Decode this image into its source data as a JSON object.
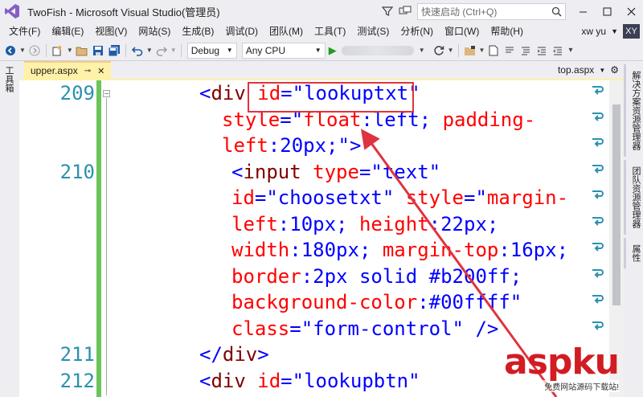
{
  "window": {
    "title": "TwoFish - Microsoft Visual Studio(管理员)",
    "quick_launch_placeholder": "快速启动 (Ctrl+Q)"
  },
  "menu": {
    "items": [
      "文件(F)",
      "编辑(E)",
      "视图(V)",
      "网站(S)",
      "生成(B)",
      "调试(D)",
      "团队(M)",
      "工具(T)",
      "测试(S)",
      "分析(N)",
      "窗口(W)",
      "帮助(H)"
    ],
    "user_name": "xw yu",
    "user_initials": "XY"
  },
  "toolbar": {
    "config_value": "Debug",
    "platform_value": "Any CPU"
  },
  "left_panel": {
    "label": "工具箱"
  },
  "right_panel": {
    "tabs": [
      "解决方案资源管理器",
      "团队资源管理器",
      "属性"
    ]
  },
  "tabs": {
    "active": "upper.aspx",
    "other": "top.aspx"
  },
  "editor": {
    "lines": [
      {
        "num": "209",
        "segments": [
          {
            "t": "<",
            "c": "str"
          },
          {
            "t": "div",
            "c": "tag"
          },
          {
            "t": " ",
            "c": "plain"
          },
          {
            "t": "id",
            "c": "attr"
          },
          {
            "t": "=\"lookuptxt\"",
            "c": "str"
          }
        ]
      },
      {
        "num": "",
        "segments": [
          {
            "t": "style",
            "c": "attr"
          },
          {
            "t": "=\"",
            "c": "str"
          },
          {
            "t": "float",
            "c": "attr"
          },
          {
            "t": ":left; ",
            "c": "str"
          },
          {
            "t": "padding-",
            "c": "attr"
          }
        ]
      },
      {
        "num": "",
        "segments": [
          {
            "t": "left",
            "c": "attr"
          },
          {
            "t": ":20px;\">",
            "c": "str"
          }
        ]
      },
      {
        "num": "210",
        "segments": [
          {
            "t": "<",
            "c": "str"
          },
          {
            "t": "input",
            "c": "tag"
          },
          {
            "t": " ",
            "c": "plain"
          },
          {
            "t": "type",
            "c": "attr"
          },
          {
            "t": "=\"text\"",
            "c": "str"
          }
        ]
      },
      {
        "num": "",
        "segments": [
          {
            "t": "id",
            "c": "attr"
          },
          {
            "t": "=\"choosetxt\" ",
            "c": "str"
          },
          {
            "t": "style",
            "c": "attr"
          },
          {
            "t": "=\"",
            "c": "str"
          },
          {
            "t": "margin-",
            "c": "attr"
          }
        ]
      },
      {
        "num": "",
        "segments": [
          {
            "t": "left",
            "c": "attr"
          },
          {
            "t": ":10px; ",
            "c": "str"
          },
          {
            "t": "height",
            "c": "attr"
          },
          {
            "t": ":22px;",
            "c": "str"
          }
        ]
      },
      {
        "num": "",
        "segments": [
          {
            "t": "width",
            "c": "attr"
          },
          {
            "t": ":180px; ",
            "c": "str"
          },
          {
            "t": "margin-top",
            "c": "attr"
          },
          {
            "t": ":16px;",
            "c": "str"
          }
        ]
      },
      {
        "num": "",
        "segments": [
          {
            "t": "border",
            "c": "attr"
          },
          {
            "t": ":2px solid #b200ff;",
            "c": "str"
          }
        ]
      },
      {
        "num": "",
        "segments": [
          {
            "t": "background-color",
            "c": "attr"
          },
          {
            "t": ":#00ffff\"",
            "c": "str"
          }
        ]
      },
      {
        "num": "",
        "segments": [
          {
            "t": "class",
            "c": "attr"
          },
          {
            "t": "=\"form-control\" />",
            "c": "str"
          }
        ]
      },
      {
        "num": "211",
        "segments": [
          {
            "t": "</",
            "c": "str"
          },
          {
            "t": "div",
            "c": "tag"
          },
          {
            "t": ">",
            "c": "str"
          }
        ]
      },
      {
        "num": "212",
        "segments": [
          {
            "t": "<",
            "c": "str"
          },
          {
            "t": "div",
            "c": "tag"
          },
          {
            "t": " ",
            "c": "plain"
          },
          {
            "t": "id",
            "c": "attr"
          },
          {
            "t": "=\"lookupbtn\"",
            "c": "str"
          }
        ]
      }
    ]
  },
  "watermark": {
    "brand": "aspku",
    "tagline": "免费网站源码下载站!"
  },
  "colors": {
    "highlight": "#e0333f",
    "arrow": "#e0333f",
    "change_bar": "#6bc45c",
    "active_tab": "#fff1a8"
  }
}
